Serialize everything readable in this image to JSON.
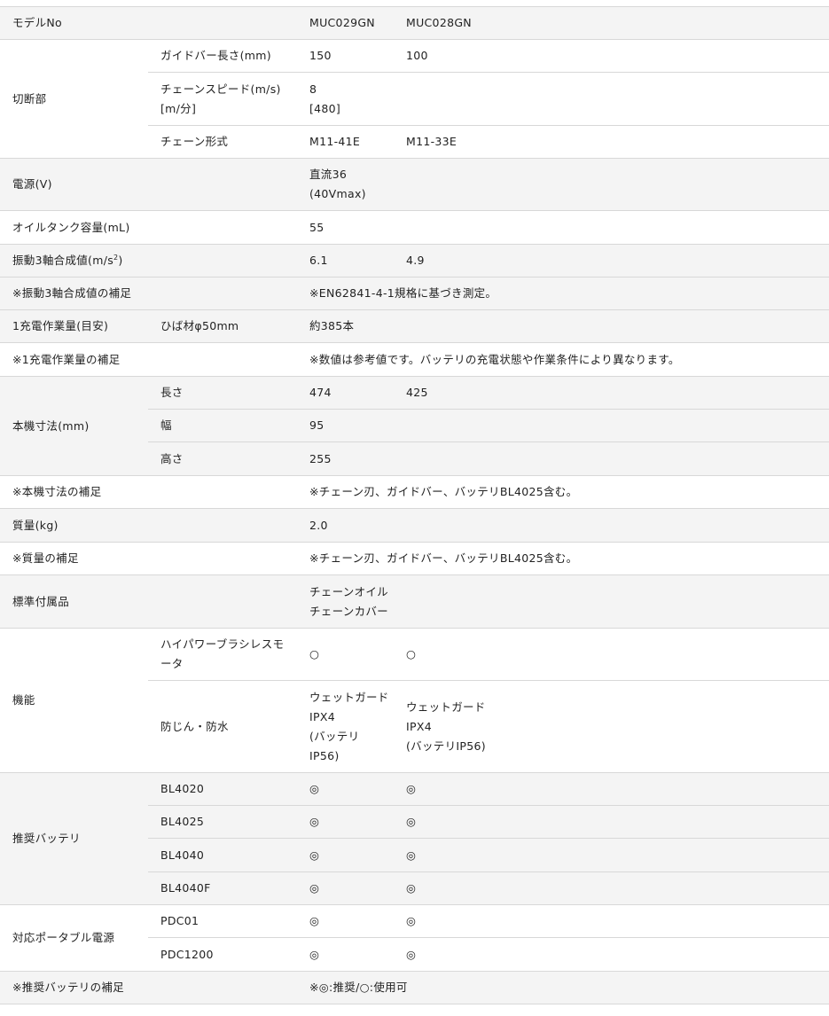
{
  "models": [
    "MUC029GN",
    "MUC028GN"
  ],
  "rows": {
    "model_no": {
      "label": "モデルNo"
    },
    "cutting": {
      "label": "切断部",
      "guide_bar": {
        "label": "ガイドバー長さ(mm)",
        "values": [
          "150",
          "100"
        ]
      },
      "chain_speed": {
        "label": "チェーンスピード(m/s)\n[m/分]",
        "value": "8\n[480]"
      },
      "chain_type": {
        "label": "チェーン形式",
        "values": [
          "M11-41E",
          "M11-33E"
        ]
      }
    },
    "power": {
      "label": "電源(V)",
      "value": "直流36\n(40Vmax)"
    },
    "oil_tank": {
      "label": "オイルタンク容量(mL)",
      "value": "55"
    },
    "vibration": {
      "label_prefix": "振動3軸合成値(m/s",
      "label_sup": "2",
      "label_suffix": ")",
      "values": [
        "6.1",
        "4.9"
      ]
    },
    "vibration_note": {
      "label": "※振動3軸合成値の補足",
      "value": "※EN62841-4-1規格に基づき測定。"
    },
    "work_per_charge": {
      "label": "1充電作業量(目安)",
      "sub": "ひば材φ50mm",
      "value": "約385本"
    },
    "work_note": {
      "label": "※1充電作業量の補足",
      "value": "※数値は参考値です。バッテリの充電状態や作業条件により異なります。"
    },
    "dimensions": {
      "label": "本機寸法(mm)",
      "length": {
        "label": "長さ",
        "values": [
          "474",
          "425"
        ]
      },
      "width": {
        "label": "幅",
        "value": "95"
      },
      "height": {
        "label": "高さ",
        "value": "255"
      }
    },
    "dimensions_note": {
      "label": "※本機寸法の補足",
      "value": "※チェーン刃、ガイドバー、バッテリBL4025含む。"
    },
    "mass": {
      "label": "質量(kg)",
      "value": "2.0"
    },
    "mass_note": {
      "label": "※質量の補足",
      "value": "※チェーン刃、ガイドバー、バッテリBL4025含む。"
    },
    "accessories": {
      "label": "標準付属品",
      "value": "チェーンオイル\nチェーンカバー"
    },
    "features": {
      "label": "機能",
      "motor": {
        "label": "ハイパワーブラシレスモ\nータ",
        "values": [
          "○",
          "○"
        ]
      },
      "dust_water": {
        "label": "防じん・防水",
        "values": [
          "ウェットガード\nIPX4\n(バッテリ\nIP56)",
          "ウェットガード\nIPX4\n(バッテリIP56)"
        ]
      }
    },
    "batteries": {
      "label": "推奨バッテリ",
      "items": [
        {
          "name": "BL4020",
          "values": [
            "◎",
            "◎"
          ]
        },
        {
          "name": "BL4025",
          "values": [
            "◎",
            "◎"
          ]
        },
        {
          "name": "BL4040",
          "values": [
            "◎",
            "◎"
          ]
        },
        {
          "name": "BL4040F",
          "values": [
            "◎",
            "◎"
          ]
        }
      ]
    },
    "portable_power": {
      "label": "対応ポータブル電源",
      "items": [
        {
          "name": "PDC01",
          "values": [
            "◎",
            "◎"
          ]
        },
        {
          "name": "PDC1200",
          "values": [
            "◎",
            "◎"
          ]
        }
      ]
    },
    "battery_note": {
      "label": "※推奨バッテリの補足",
      "value": "※◎:推奨/○:使用可"
    }
  }
}
